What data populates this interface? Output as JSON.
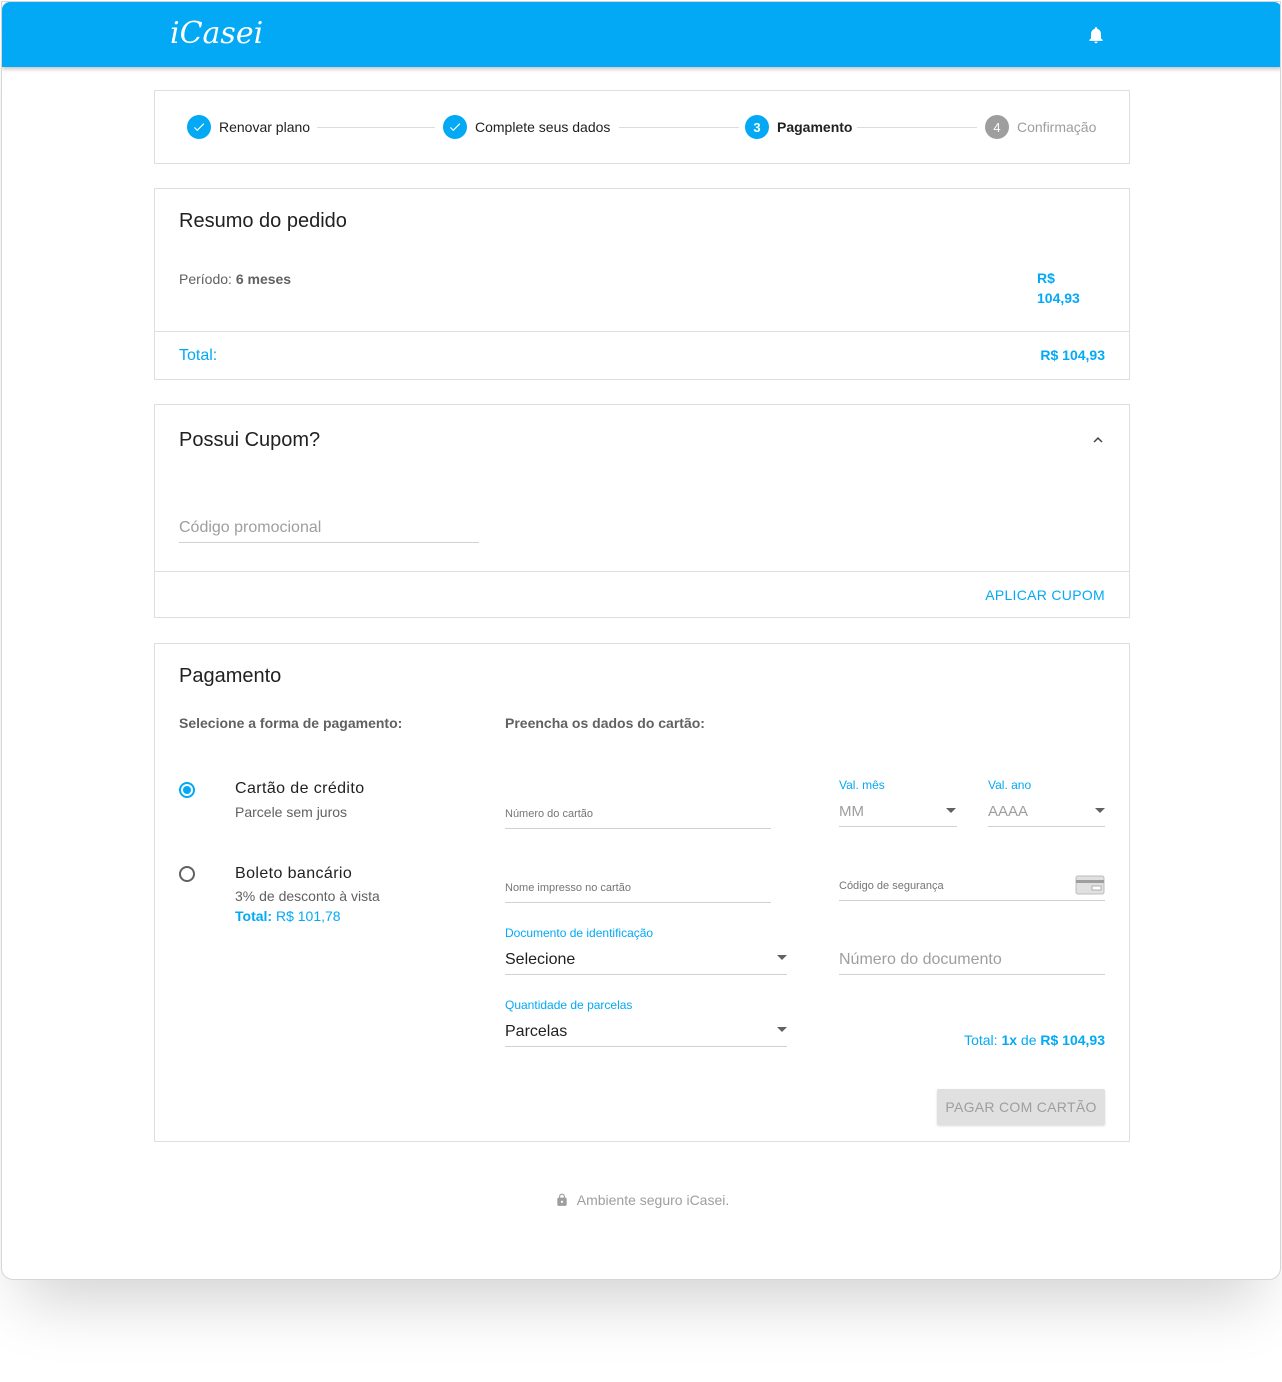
{
  "header": {
    "logo": "iCasei",
    "bell_icon": "bell-icon"
  },
  "stepper": {
    "steps": [
      {
        "label": "Renovar plano",
        "state": "done"
      },
      {
        "label": "Complete seus dados",
        "state": "done"
      },
      {
        "label": "Pagamento",
        "number": "3",
        "state": "active"
      },
      {
        "label": "Confirmação",
        "number": "4",
        "state": "pending"
      }
    ]
  },
  "summary": {
    "title": "Resumo do pedido",
    "period_label": "Período:",
    "period_value": "6 meses",
    "price_currency": "R$",
    "price_amount": "104,93",
    "total_label": "Total:",
    "total_value": "R$ 104,93"
  },
  "coupon": {
    "title": "Possui Cupom?",
    "placeholder": "Código promocional",
    "apply_label": "APLICAR CUPOM"
  },
  "payment": {
    "title": "Pagamento",
    "select_label": "Selecione a forma de pagamento:",
    "fill_label": "Preencha os dados do cartão:",
    "methods": [
      {
        "title": "Cartão de crédito",
        "subtitle": "Parcele sem juros",
        "selected": true
      },
      {
        "title": "Boleto bancário",
        "subtitle": "3% de desconto à vista",
        "total_label": "Total:",
        "total_value": "R$ 101,78",
        "selected": false
      }
    ],
    "card_number_label": "Número do cartão",
    "month_label": "Val. mês",
    "month_value": "MM",
    "year_label": "Val. ano",
    "year_value": "AAAA",
    "name_label": "Nome impresso no cartão",
    "cvv_label": "Código de segurança",
    "doc_type_label": "Documento de identificação",
    "doc_type_value": "Selecione",
    "doc_number_placeholder": "Número do documento",
    "installments_label": "Quantidade de parcelas",
    "installments_value": "Parcelas",
    "total_label": "Total:",
    "total_count": "1x",
    "total_de": "de",
    "total_value": "R$ 104,93",
    "pay_button": "PAGAR COM CARTÃO"
  },
  "footer": {
    "text": "Ambiente seguro iCasei."
  },
  "colors": {
    "primary": "#03a9f4",
    "disabled_button": "#e0e0e0"
  }
}
